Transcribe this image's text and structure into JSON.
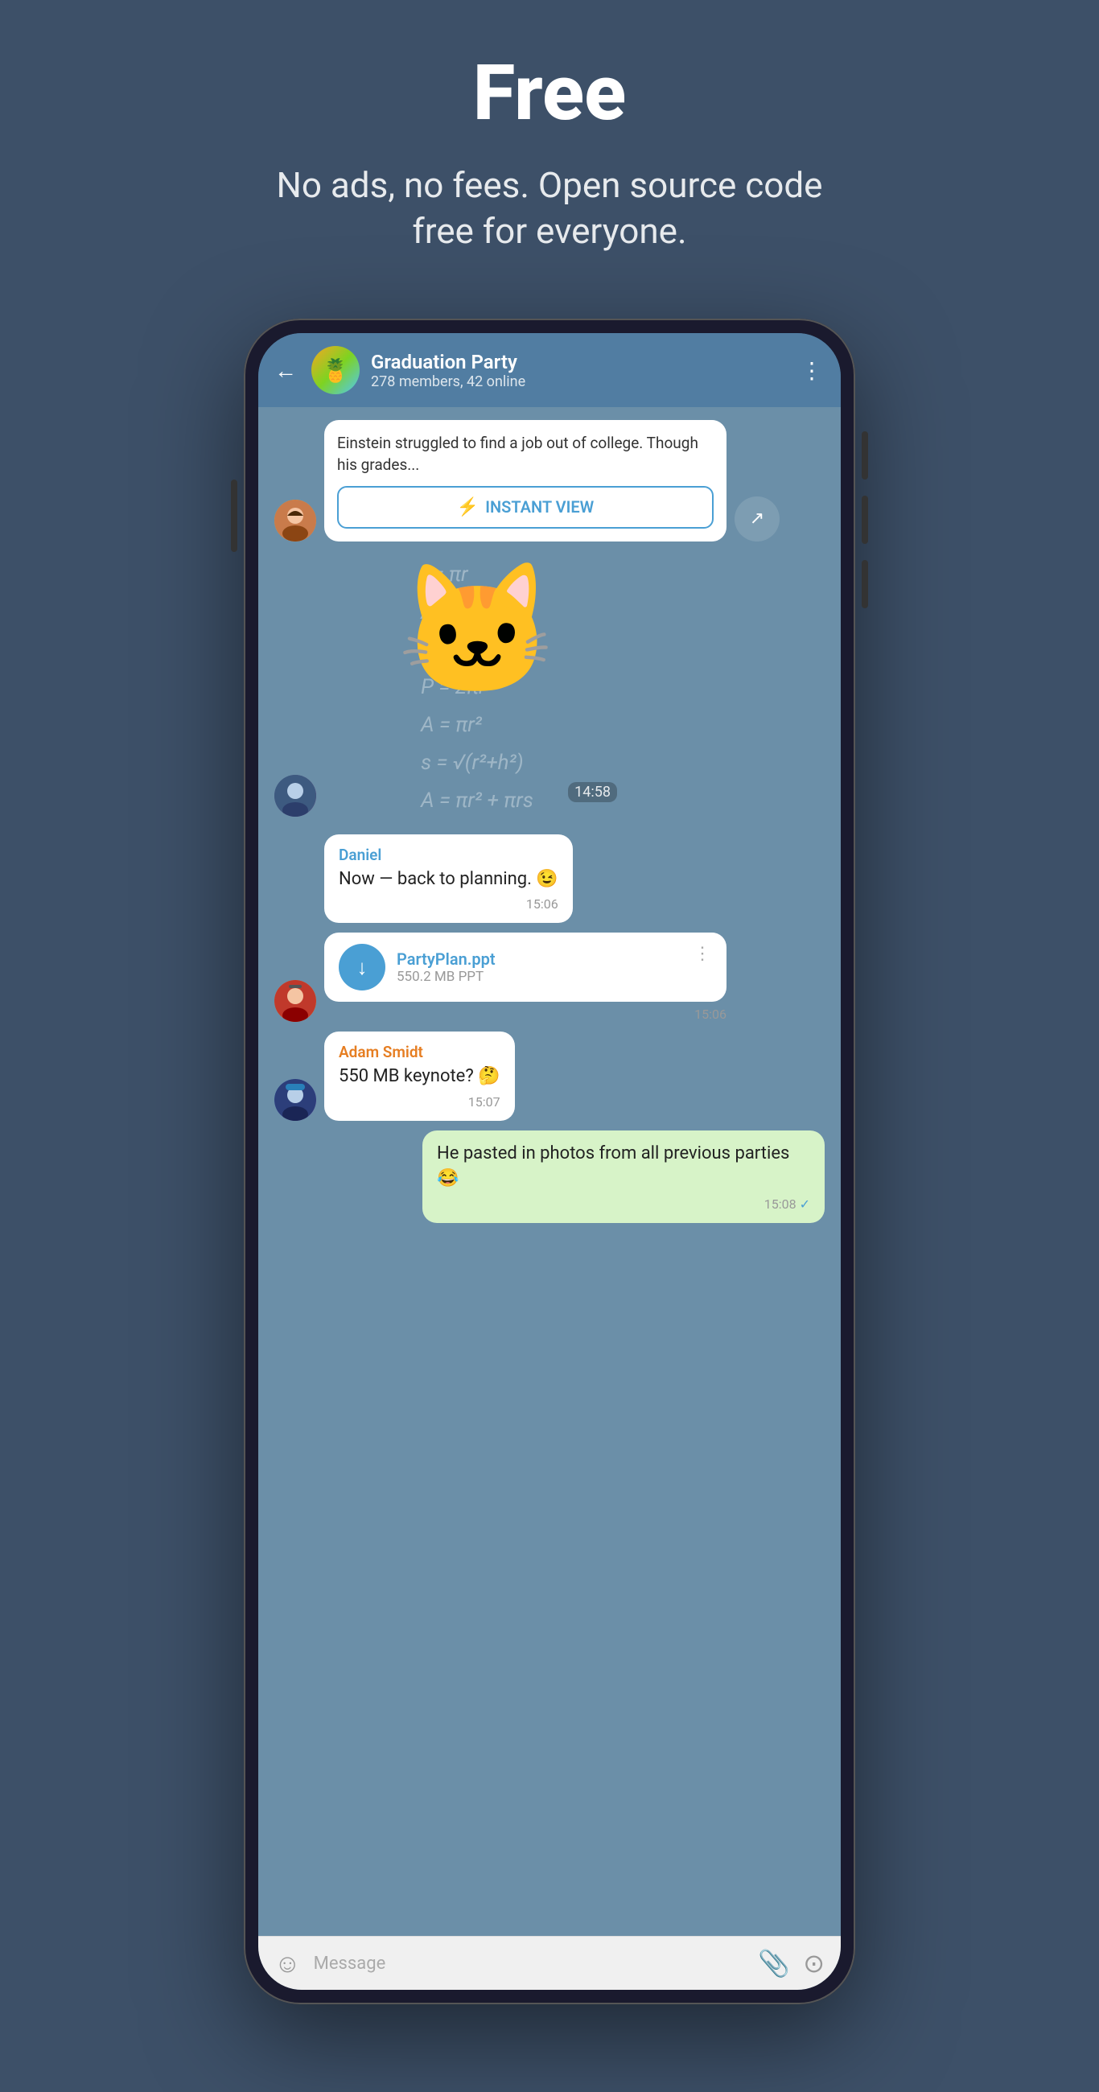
{
  "header": {
    "title": "Free",
    "subtitle": "No ads, no fees. Open source code free for everyone."
  },
  "chat": {
    "back_label": "←",
    "group_name": "Graduation Party",
    "group_members": "278 members, 42 online",
    "menu_icon": "⋮",
    "messages": [
      {
        "id": "link-preview",
        "type": "link",
        "text": "Einstein struggled to find a job out of college. Though his grades...",
        "button_label": "INSTANT VIEW",
        "lightning": "⚡"
      },
      {
        "id": "sticker-msg",
        "type": "sticker",
        "time": "14:58"
      },
      {
        "id": "daniel-msg",
        "type": "text",
        "sender": "Daniel",
        "text": "Now — back to planning. 😉",
        "time": "15:06"
      },
      {
        "id": "file-msg",
        "type": "file",
        "file_name": "PartyPlan.ppt",
        "file_size": "550.2 MB PPT",
        "time": "15:06",
        "download_icon": "↓"
      },
      {
        "id": "adam-msg",
        "type": "text",
        "sender": "Adam Smidt",
        "text": "550 MB keynote? 🤔",
        "time": "15:07"
      },
      {
        "id": "own-msg",
        "type": "own",
        "text": "He pasted in photos from all previous parties 😂",
        "time": "15:08"
      }
    ],
    "input_placeholder": "Message",
    "input_icons": {
      "emoji": "☺",
      "attach": "📎",
      "camera": "⊙"
    }
  },
  "math_formulas": "A = πr²\nV = l³\nP = 2πr\nA = πr²\ns = √(r²+h²)\nA = πr² + πrs",
  "colors": {
    "background": "#3d5068",
    "header_bg": "#517da2",
    "chat_bg": "#6b8fa8",
    "accent": "#4a9fd4",
    "own_msg_bg": "#d7f3c8"
  }
}
